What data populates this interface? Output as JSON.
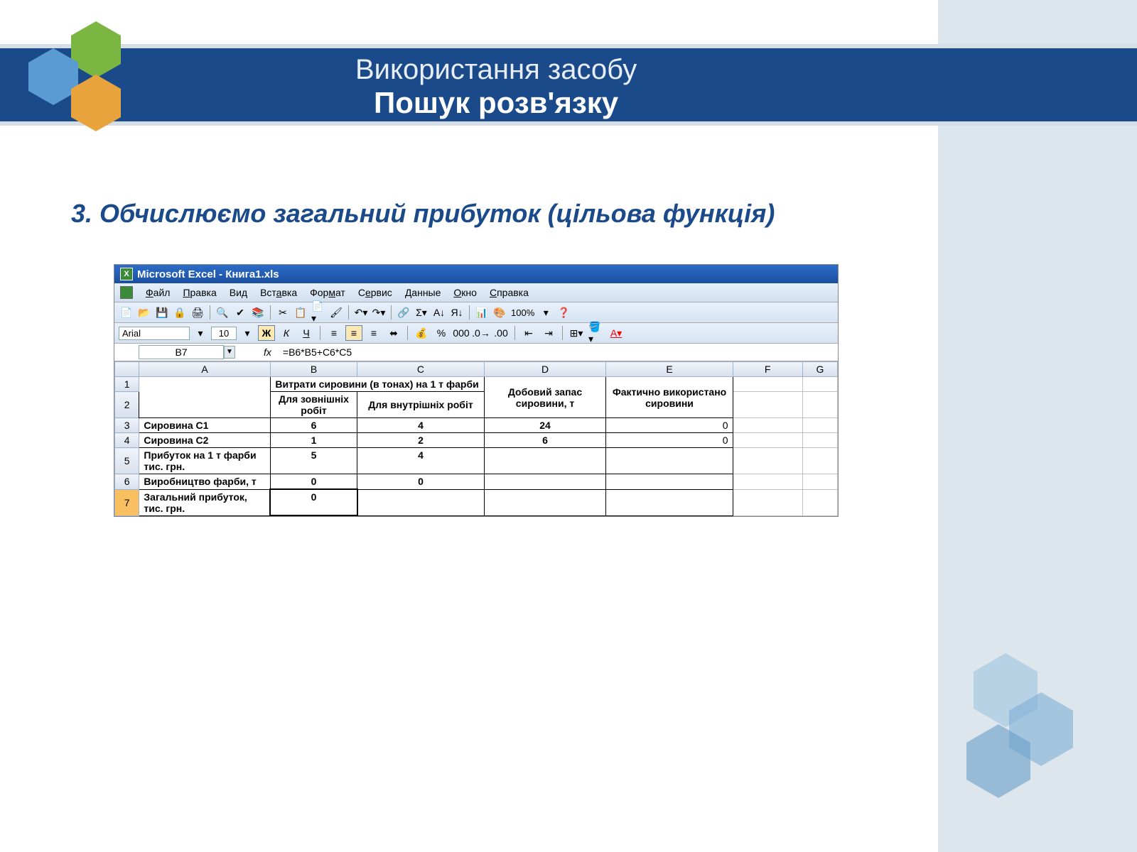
{
  "slide": {
    "title_line1": "Використання засобу",
    "title_line2": "Пошук розв'язку",
    "step_heading": "3. Обчислюємо загальний прибуток (цільова функція)"
  },
  "excel": {
    "window_title": "Microsoft Excel - Книга1.xls",
    "menus": {
      "file": "Файл",
      "edit": "Правка",
      "view": "Вид",
      "insert": "Вставка",
      "format": "Формат",
      "tools": "Сервис",
      "data": "Данные",
      "window": "Окно",
      "help": "Справка"
    },
    "font_name": "Arial",
    "font_size": "10",
    "zoom": "100%",
    "name_box": "B7",
    "fx_label": "fx",
    "formula": "=B6*B5+C6*C5",
    "columns": [
      "A",
      "B",
      "C",
      "D",
      "E",
      "F",
      "G"
    ],
    "row_nums": [
      "1",
      "2",
      "3",
      "4",
      "5",
      "6",
      "7"
    ],
    "headers": {
      "bc_merge": "Витрати сировини (в тонах) на 1 т фарби",
      "b2": "Для зовнішніх робіт",
      "c2": "Для внутрішніх робіт",
      "d_merge": "Добовий запас сировини, т",
      "e_merge": "Фактично використано сировини"
    },
    "rows": {
      "r3": {
        "a": "Сировина С1",
        "b": "6",
        "c": "4",
        "d": "24",
        "e": "0"
      },
      "r4": {
        "a": "Сировина С2",
        "b": "1",
        "c": "2",
        "d": "6",
        "e": "0"
      },
      "r5": {
        "a": "Прибуток на 1 т фарби тис. грн.",
        "b": "5",
        "c": "4"
      },
      "r6": {
        "a": "Виробництво фарби, т",
        "b": "0",
        "c": "0"
      },
      "r7": {
        "a": "Загальний прибуток, тис. грн.",
        "b": "0"
      }
    },
    "fmt_buttons": {
      "bold": "Ж",
      "italic": "К",
      "underline": "Ч"
    }
  }
}
